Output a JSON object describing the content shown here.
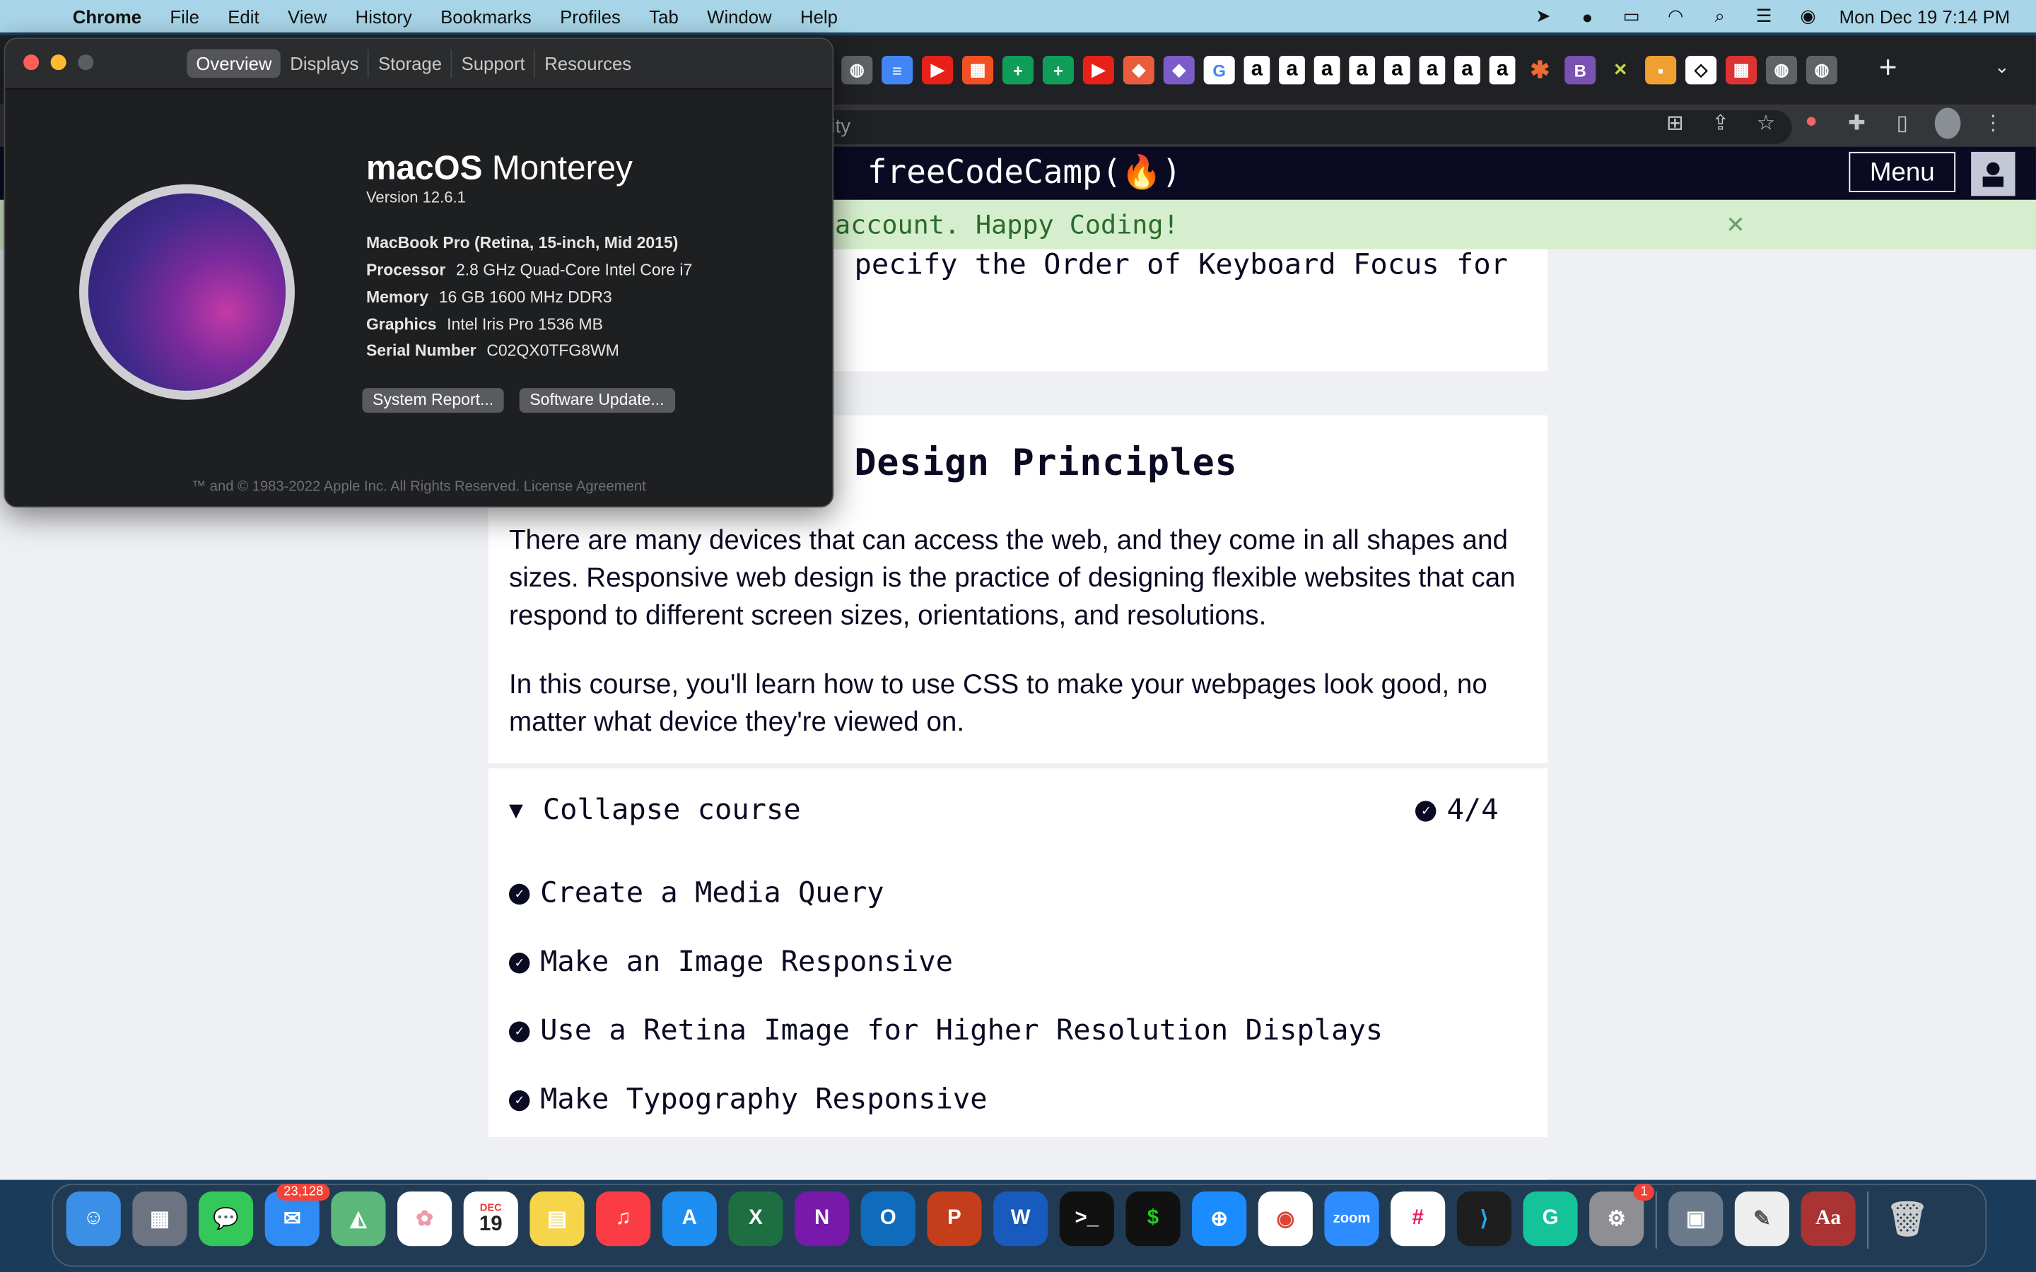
{
  "menubar": {
    "apple_icon": "apple-icon",
    "items": [
      "Chrome",
      "File",
      "Edit",
      "View",
      "History",
      "Bookmarks",
      "Profiles",
      "Tab",
      "Window",
      "Help"
    ],
    "clock": "Mon Dec 19  7:14 PM"
  },
  "browser": {
    "omnibox_text": "ity",
    "new_tab": "+"
  },
  "fcc": {
    "logo": "freeCodeCamp(🔥)",
    "menu_label": "Menu",
    "flash_text": "account. Happy Coding!",
    "flash_close": "✕",
    "prev_lesson": "pecify the Order of Keyboard Focus for",
    "section_title": "Design Principles",
    "para1": "There are many devices that can access the web, and they come in all shapes and sizes. Responsive web design is the practice of designing flexible websites that can respond to different screen sizes, orientations, and resolutions.",
    "para2": "In this course, you'll learn how to use CSS to make your webpages look good, no matter what device they're viewed on.",
    "collapse_label": "Collapse course",
    "progress": "4/4",
    "challenges": [
      "Create a Media Query",
      "Make an Image Responsive",
      "Use a Retina Image for Higher Resolution Displays",
      "Make Typography Responsive"
    ]
  },
  "about": {
    "tabs": [
      "Overview",
      "Displays",
      "Storage",
      "Support",
      "Resources"
    ],
    "os_name_bold": "macOS",
    "os_name": "Monterey",
    "version": "Version 12.6.1",
    "model": "MacBook Pro (Retina, 15-inch, Mid 2015)",
    "processor_key": "Processor",
    "processor_val": "2.8 GHz Quad-Core Intel Core i7",
    "memory_key": "Memory",
    "memory_val": "16 GB 1600 MHz DDR3",
    "graphics_key": "Graphics",
    "graphics_val": "Intel Iris Pro 1536 MB",
    "serial_key": "Serial Number",
    "serial_val": "C02QX0TFG8WM",
    "btn_report": "System Report...",
    "btn_update": "Software Update...",
    "legal": "™ and © 1983-2022 Apple Inc. All Rights Reserved. License Agreement"
  },
  "dock": {
    "mail_badge": "23,128",
    "calendar_month": "DEC",
    "calendar_day": "19",
    "settings_badge": "1",
    "zoom_label": "zoom"
  }
}
